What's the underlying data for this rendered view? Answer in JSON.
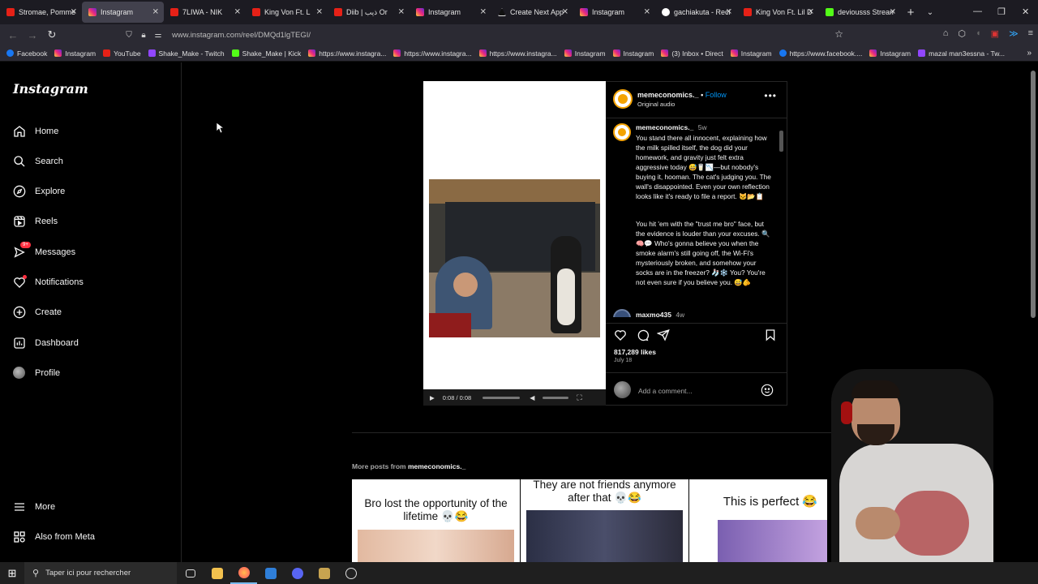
{
  "browser": {
    "tabs": [
      {
        "label": "Stromae, Pomme",
        "icon": "yt",
        "active": false
      },
      {
        "label": "Instagram",
        "icon": "ig",
        "active": true
      },
      {
        "label": "7LIWA - NIK",
        "icon": "yt",
        "active": false
      },
      {
        "label": "King Von Ft. L",
        "icon": "yt",
        "active": false
      },
      {
        "label": "Diib | ذيب Or",
        "icon": "yt",
        "active": false
      },
      {
        "label": "Instagram",
        "icon": "ig",
        "active": false
      },
      {
        "label": "Create Next App",
        "icon": "vc",
        "active": false
      },
      {
        "label": "Instagram",
        "icon": "ig",
        "active": false
      },
      {
        "label": "gachiakuta - Reci",
        "icon": "gg",
        "active": false
      },
      {
        "label": "King Von Ft. Lil D",
        "icon": "yt",
        "active": false
      },
      {
        "label": "deviousss Stream",
        "icon": "kk",
        "active": false
      }
    ],
    "url": "www.instagram.com/reel/DMQd1lgTEGI/",
    "bookmarks": [
      {
        "label": "Facebook",
        "icon": "fb"
      },
      {
        "label": "Instagram",
        "icon": "ig"
      },
      {
        "label": "YouTube",
        "icon": "yt"
      },
      {
        "label": "Shake_Make - Twitch",
        "icon": "tw"
      },
      {
        "label": "Shake_Make | Kick",
        "icon": "kk"
      },
      {
        "label": "https://www.instagra...",
        "icon": "ig"
      },
      {
        "label": "https://www.instagra...",
        "icon": "ig"
      },
      {
        "label": "https://www.instagra...",
        "icon": "ig"
      },
      {
        "label": "Instagram",
        "icon": "ig"
      },
      {
        "label": "Instagram",
        "icon": "ig"
      },
      {
        "label": "(3) Inbox • Direct",
        "icon": "ig"
      },
      {
        "label": "Instagram",
        "icon": "ig"
      },
      {
        "label": "https://www.facebook....",
        "icon": "fb"
      },
      {
        "label": "Instagram",
        "icon": "ig"
      },
      {
        "label": "mazal man3essna - Tw...",
        "icon": "tw"
      }
    ]
  },
  "sidebar": {
    "logo": "Instagram",
    "items": [
      {
        "label": "Home",
        "icon": "home-icon"
      },
      {
        "label": "Search",
        "icon": "search-icon"
      },
      {
        "label": "Explore",
        "icon": "compass-icon"
      },
      {
        "label": "Reels",
        "icon": "reels-icon"
      },
      {
        "label": "Messages",
        "icon": "messenger-icon",
        "badge": "9+"
      },
      {
        "label": "Notifications",
        "icon": "heart-icon"
      },
      {
        "label": "Create",
        "icon": "plus-square-icon"
      },
      {
        "label": "Dashboard",
        "icon": "chart-icon"
      },
      {
        "label": "Profile",
        "icon": "avatar"
      }
    ],
    "more": "More",
    "meta": "Also from Meta"
  },
  "post": {
    "username": "memeconomics._",
    "follow": "Follow",
    "audio": "Original audio",
    "caption_time": "5w",
    "caption_p1": "You stand there all innocent, explaining how the milk spilled itself, the dog did your homework, and gravity just felt extra aggressive today 😅🥛📉—but nobody's buying it, hooman. The cat's judging you. The wall's disappointed. Even your own reflection looks like it's ready to file a report. 🐱📂📋",
    "caption_p2": "You hit 'em with the \"trust me bro\" face, but the evidence is louder than your excuses. 🔍🧠💬 Who's gonna believe you when the smoke alarm's still going off, the Wi-Fi's mysteriously broken, and somehow your socks are in the freezer? 🧦❄️ You? You're not even sure if you believe you. 😅🫵",
    "comment_user": "maxmo435",
    "comment_time": "4w",
    "likes": "817,289 likes",
    "date": "July 18",
    "comment_placeholder": "Add a comment...",
    "video_time": "0:08 / 0:08"
  },
  "more_posts": {
    "prefix": "More posts from",
    "username": "memeconomics._",
    "thumbs": [
      {
        "text": "Bro lost the opportunity of the lifetime 💀😂"
      },
      {
        "text": "They are not friends anymore after that 💀😂"
      },
      {
        "text": "This is perfect 😂"
      }
    ]
  },
  "taskbar": {
    "search_placeholder": "Taper ici pour rechercher"
  }
}
